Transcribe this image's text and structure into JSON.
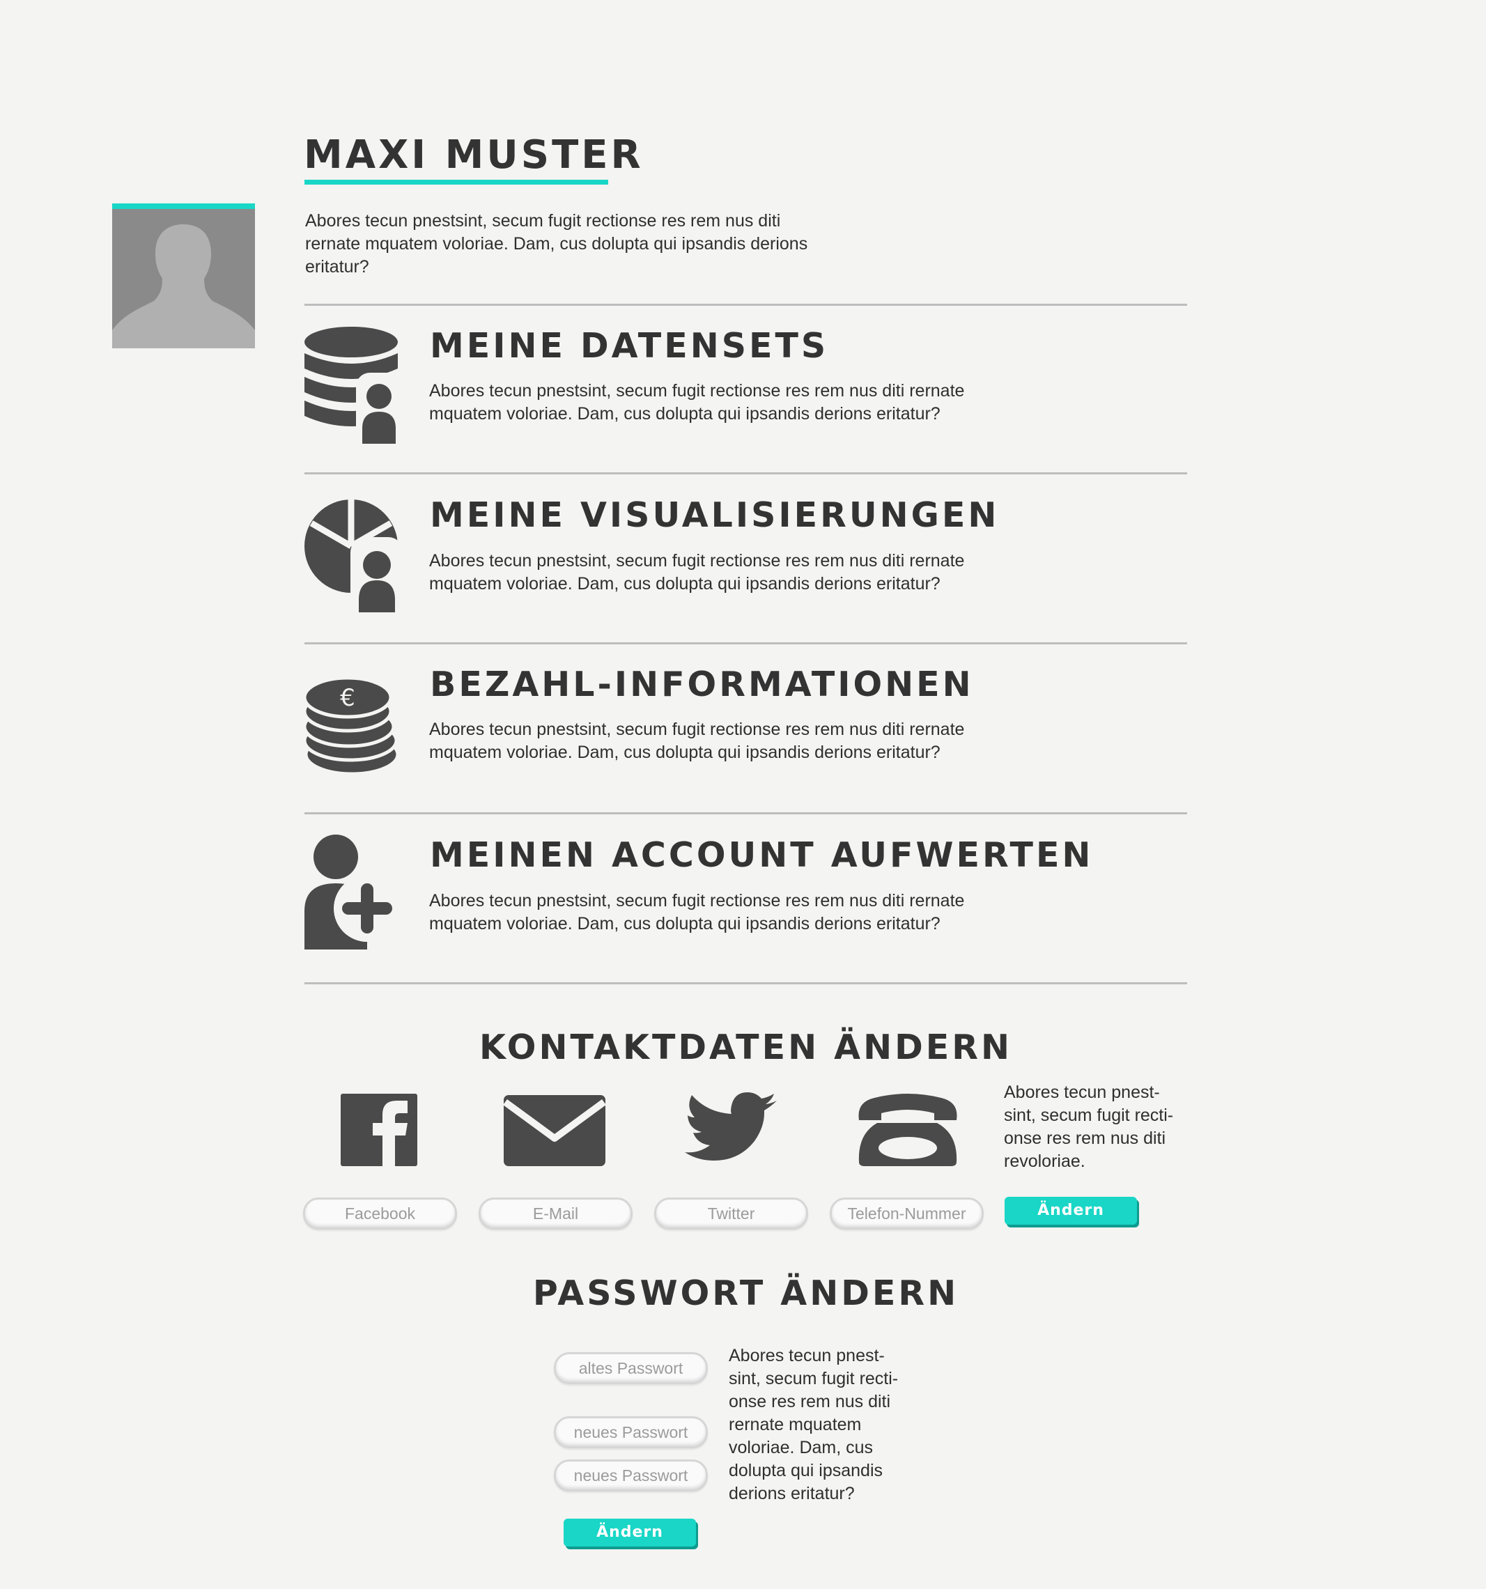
{
  "profile": {
    "name": "MAXI MUSTER",
    "intro": "Abores tecun pnestsint, secum fugit rectionse res rem nus diti rernate mquatem voloriae. Dam, cus dolupta qui ipsandis derions eritatur?"
  },
  "sections": [
    {
      "title": "MEINE DATENSETS",
      "icon": "database-user-icon",
      "text": "Abores tecun pnestsint, secum fugit rectionse res rem nus diti rernate mquatem voloriae. Dam, cus dolupta qui ipsandis derions eritatur?"
    },
    {
      "title": "MEINE VISUALISIERUNGEN",
      "icon": "pie-chart-user-icon",
      "text": "Abores tecun pnestsint, secum fugit rectionse res rem nus diti rernate mquatem voloriae. Dam, cus dolupta qui ipsandis derions eritatur?"
    },
    {
      "title": "BEZAHL-INFORMATIONEN",
      "icon": "euro-coins-icon",
      "text": "Abores tecun pnestsint, secum fugit rectionse res rem nus diti rernate mquatem voloriae. Dam, cus dolupta qui ipsandis derions eritatur?"
    },
    {
      "title": "MEINEN ACCOUNT AUFWERTEN",
      "icon": "user-add-icon",
      "text": "Abores tecun pnestsint, secum fugit rectionse res rem nus diti rernate mquatem voloriae. Dam, cus dolupta qui ipsandis derions eritatur?"
    }
  ],
  "contact": {
    "title": "KONTAKTDATEN ÄNDERN",
    "note_lines": [
      "Abores tecun pnest-",
      "sint, secum fugit recti-",
      "onse res rem nus diti",
      "revoloriae."
    ],
    "fields": [
      {
        "icon": "facebook-icon",
        "placeholder": "Facebook"
      },
      {
        "icon": "mail-icon",
        "placeholder": "E-Mail"
      },
      {
        "icon": "twitter-icon",
        "placeholder": "Twitter"
      },
      {
        "icon": "telephone-icon",
        "placeholder": "Telefon-Nummer"
      }
    ],
    "button_label": "Ändern"
  },
  "password": {
    "title": "PASSWORT ÄNDERN",
    "old_placeholder": "altes Passwort",
    "new_placeholder": "neues Passwort",
    "confirm_placeholder": "neues Passwort",
    "note_lines": [
      "Abores tecun pnest-",
      "sint, secum fugit recti-",
      "onse res rem nus diti",
      "rernate mquatem",
      "voloriae. Dam, cus",
      "dolupta qui ipsandis",
      "derions eritatur?"
    ],
    "button_label": "Ändern"
  },
  "colors": {
    "accent": "#19d6c6",
    "icon": "#4a4a4a",
    "background": "#f4f4f2"
  }
}
